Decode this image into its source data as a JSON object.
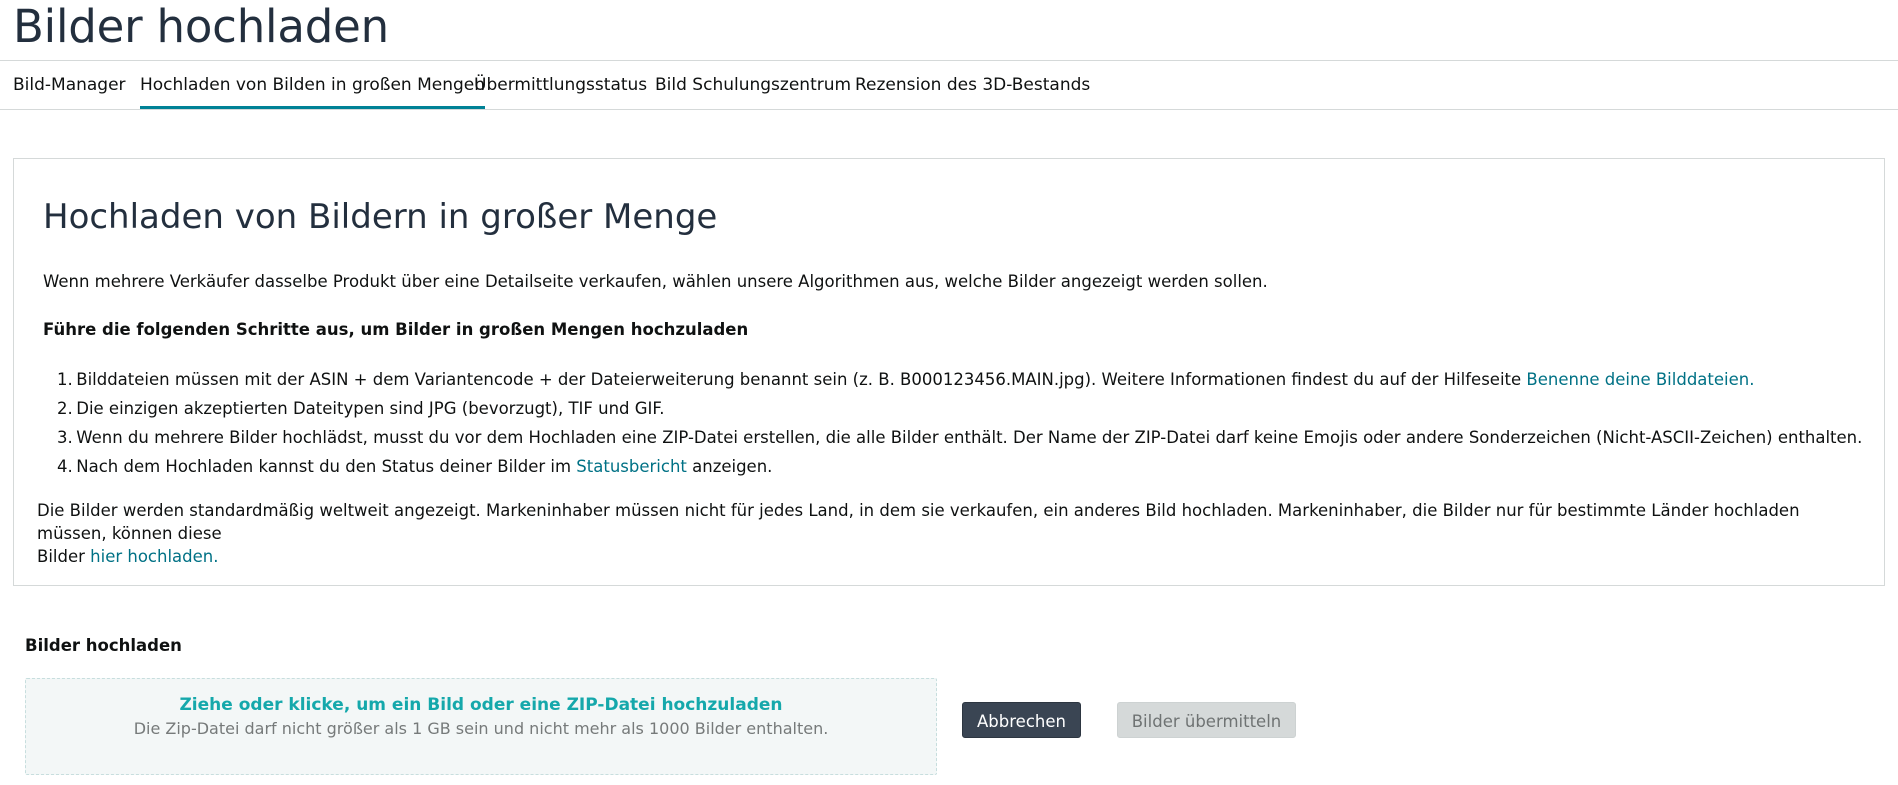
{
  "page": {
    "title": "Bilder hochladen"
  },
  "tabs": [
    {
      "label": "Bild-Manager",
      "active": false
    },
    {
      "label": "Hochladen von Bilden in großen Mengen",
      "active": true
    },
    {
      "label": "Übermittlungsstatus",
      "active": false
    },
    {
      "label": "Bild Schulungszentrum",
      "active": false
    },
    {
      "label": "Rezension des 3D-Bestands",
      "active": false
    }
  ],
  "info": {
    "heading": "Hochladen von Bildern in großer Menge",
    "intro": "Wenn mehrere Verkäufer dasselbe Produkt über eine Detailseite verkaufen, wählen unsere Algorithmen aus, welche Bilder angezeigt werden sollen.",
    "steps_title": "Führe die folgenden Schritte aus, um Bilder in großen Mengen hochzuladen",
    "steps": [
      {
        "num": "1.",
        "text": "Bilddateien müssen mit der ASIN + dem Variantencode + der Dateierweiterung benannt sein (z. B. B000123456.MAIN.jpg). Weitere Informationen findest du auf der Hilfeseite ",
        "link": "Benenne deine Bilddateien.",
        "after": ""
      },
      {
        "num": "2.",
        "text": "Die einzigen akzeptierten Dateitypen sind JPG (bevorzugt), TIF und GIF.",
        "link": "",
        "after": ""
      },
      {
        "num": "3.",
        "text": "Wenn du mehrere Bilder hochlädst, musst du vor dem Hochladen eine ZIP-Datei erstellen, die alle Bilder enthält. Der Name der ZIP-Datei darf keine Emojis oder andere Sonderzeichen (Nicht-ASCII-Zeichen) enthalten.",
        "link": "",
        "after": ""
      },
      {
        "num": "4.",
        "text": "Nach dem Hochladen kannst du den Status deiner Bilder im ",
        "link": "Statusbericht",
        "after": " anzeigen."
      }
    ],
    "notice_line1": "Die Bilder werden standardmäßig weltweit angezeigt. Markeninhaber müssen nicht für jedes Land, in dem sie verkaufen, ein anderes Bild hochladen. Markeninhaber, die Bilder nur für bestimmte Länder hochladen müssen, können diese",
    "notice_line2": "Bilder ",
    "notice_link": "hier hochladen."
  },
  "upload": {
    "label": "Bilder hochladen",
    "dropzone_main": "Ziehe oder klicke, um ein Bild oder eine ZIP-Datei hochzuladen",
    "dropzone_sub": "Die Zip-Datei darf nicht größer als 1 GB sein und nicht mehr als 1000 Bilder enthalten.",
    "cancel_label": "Abbrechen",
    "submit_label": "Bilder übermitteln"
  },
  "colors": {
    "link": "#007185",
    "active_tab_underline": "#008296",
    "dropzone_text": "#15a8ab",
    "cancel_button_bg": "#3a4553",
    "submit_button_bg": "#d5d9d9"
  }
}
